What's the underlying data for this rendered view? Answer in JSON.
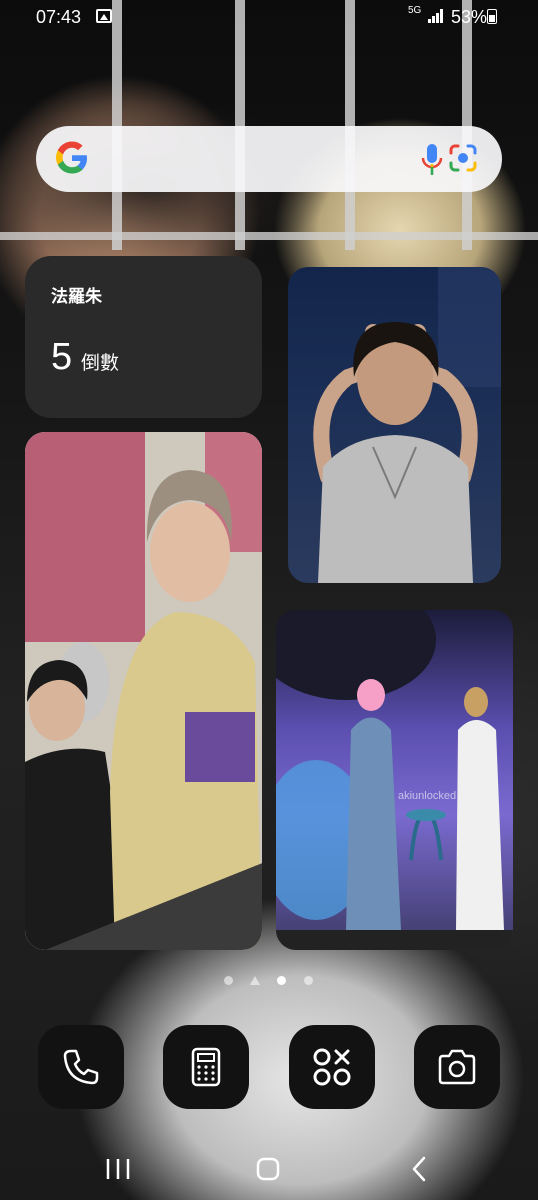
{
  "status_bar": {
    "time": "07:43",
    "network": "5G",
    "battery": "53%"
  },
  "search_bar": {
    "logo": "google-g-icon",
    "mic": "mic-icon",
    "lens": "lens-icon"
  },
  "countdown_widget": {
    "title": "法羅朱",
    "number": "5",
    "unit": "倒數"
  },
  "photo_widgets": [
    {
      "watermark": ""
    },
    {
      "watermark": ""
    },
    {
      "watermark": "akiunlocked"
    }
  ],
  "page_indicator": {
    "count": 4,
    "active_index": 2
  },
  "dock": [
    {
      "icon": "phone-icon"
    },
    {
      "icon": "calculator-icon"
    },
    {
      "icon": "apps-icon"
    },
    {
      "icon": "camera-icon"
    }
  ],
  "nav_bar": {
    "buttons": [
      "recents-icon",
      "home-icon",
      "back-icon"
    ]
  },
  "colors": {
    "google_blue": "#4285F4",
    "google_red": "#EA4335",
    "google_yellow": "#FBBC05",
    "google_green": "#34A853"
  }
}
